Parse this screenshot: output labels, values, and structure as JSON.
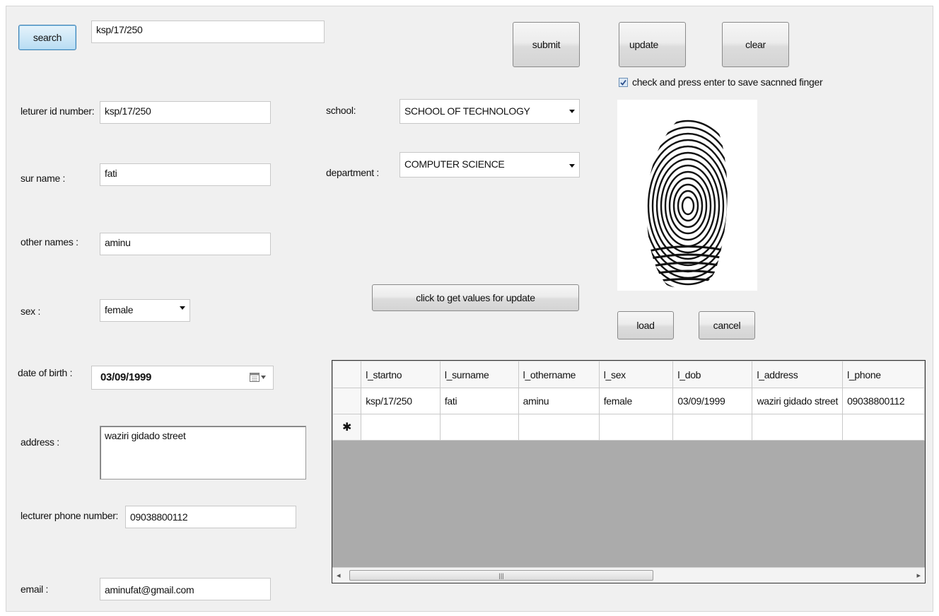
{
  "search": {
    "button_label": "search",
    "value": "ksp/17/250"
  },
  "buttons": {
    "submit": "submit",
    "update": "update",
    "clear": "clear",
    "get_values": "click to get values for update",
    "load": "load",
    "cancel": "cancel"
  },
  "checkbox": {
    "checked": true,
    "label": "check and press enter to save sacnned finger"
  },
  "fields": {
    "lecturer_id": {
      "label": "leturer id number:",
      "value": "ksp/17/250"
    },
    "surname": {
      "label": "sur name :",
      "value": "fati"
    },
    "other_names": {
      "label": "other names :",
      "value": "aminu"
    },
    "sex": {
      "label": "sex :",
      "value": "female"
    },
    "dob": {
      "label": "date of birth :",
      "value": "03/09/1999"
    },
    "address": {
      "label": "address :",
      "value": "waziri gidado street"
    },
    "phone": {
      "label": "lecturer phone number:",
      "value": "09038800112"
    },
    "email": {
      "label": "email :",
      "value": "aminufat@gmail.com"
    },
    "school": {
      "label": "school:",
      "value": "SCHOOL OF TECHNOLOGY"
    },
    "department": {
      "label": "department :",
      "value": "COMPUTER SCIENCE"
    }
  },
  "grid": {
    "columns": [
      "l_startno",
      "l_surname",
      "l_othername",
      "l_sex",
      "l_dob",
      "l_address",
      "l_phone"
    ],
    "rows": [
      [
        "ksp/17/250",
        "fati",
        "aminu",
        "female",
        "03/09/1999",
        "waziri gidado street",
        "09038800112"
      ]
    ],
    "new_row_marker": "✱"
  },
  "icons": {
    "calendar": "calendar-icon",
    "dropdown": "chevron-down-icon",
    "fingerprint": "fingerprint-image"
  }
}
